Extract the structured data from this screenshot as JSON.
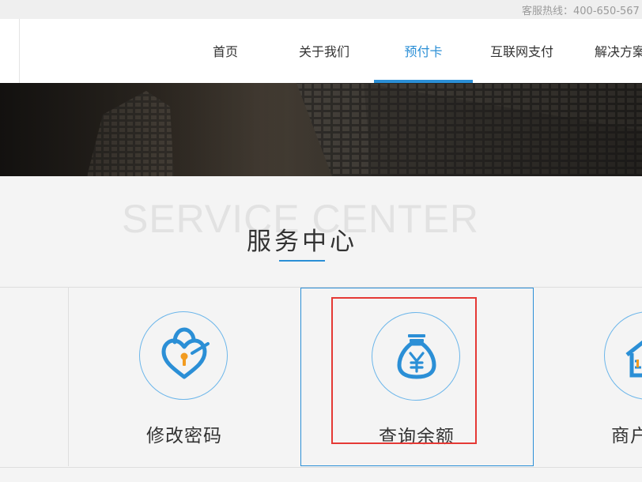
{
  "hotline": "客服热线：400-650-567",
  "nav": {
    "items": [
      {
        "label": "首页"
      },
      {
        "label": "关于我们"
      },
      {
        "label": "预付卡",
        "active": true
      },
      {
        "label": "互联网支付"
      },
      {
        "label": "解决方案"
      }
    ]
  },
  "section": {
    "title_en": "SERVICE CENTER",
    "title_cn": "服务中心"
  },
  "services": [
    {
      "label": "修改密码",
      "icon": "heart-lock-icon"
    },
    {
      "label": "查询余额",
      "icon": "money-bag-icon",
      "selected": true
    },
    {
      "label": "商户",
      "icon": "house-icon"
    }
  ],
  "colors": {
    "accent": "#2b8fd6",
    "highlight": "#e53935",
    "icon_orange": "#f29b20"
  }
}
